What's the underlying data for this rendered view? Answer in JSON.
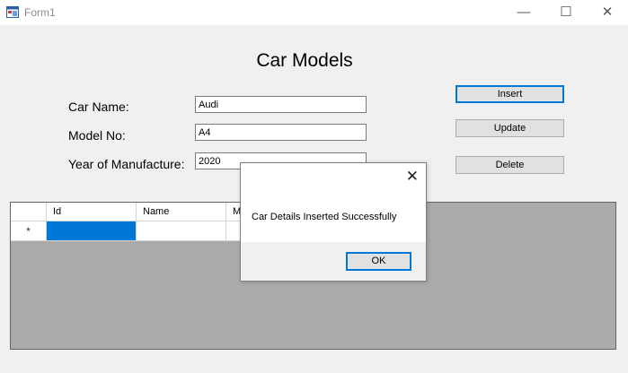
{
  "window": {
    "title": "Form1",
    "controls": {
      "minimize": "—",
      "maximize": "☐",
      "close": "✕"
    }
  },
  "form": {
    "heading": "Car Models",
    "fields": {
      "car_name": {
        "label": "Car Name:",
        "value": "Audi"
      },
      "model_no": {
        "label": "Model No:",
        "value": "A4"
      },
      "year": {
        "label": "Year of Manufacture:",
        "value": "2020"
      }
    },
    "buttons": {
      "insert": "Insert",
      "update": "Update",
      "delete": "Delete"
    }
  },
  "grid": {
    "columns": [
      "Id",
      "Name",
      "M"
    ],
    "new_row_marker": "*"
  },
  "dialog": {
    "close": "✕",
    "message": "Car Details Inserted Successfully",
    "ok": "OK"
  },
  "colors": {
    "accent": "#0078d7",
    "grid_background": "#ababab",
    "form_background": "#f0f0f0"
  }
}
